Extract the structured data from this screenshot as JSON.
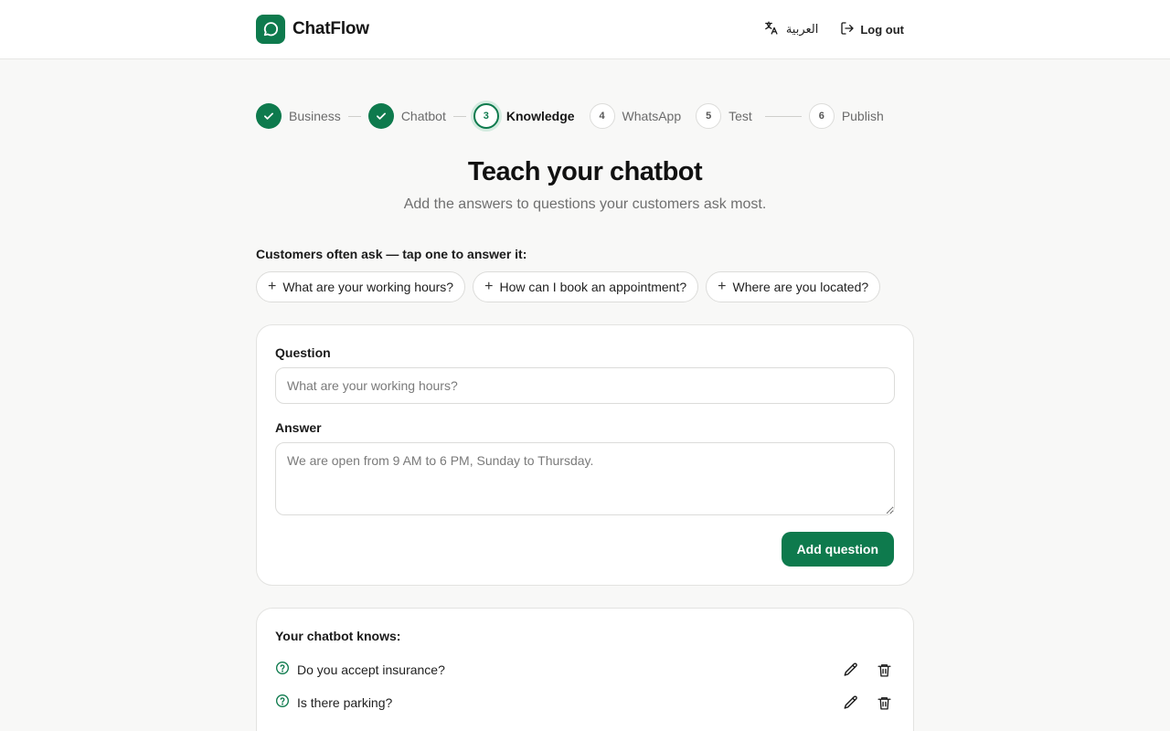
{
  "header": {
    "brand_name": "ChatFlow",
    "language_label": "العربية",
    "logout_label": "Log out"
  },
  "steps": [
    {
      "number": "1",
      "label": "Business",
      "state": "done"
    },
    {
      "number": "2",
      "label": "Chatbot",
      "state": "done"
    },
    {
      "number": "3",
      "label": "Knowledge",
      "state": "current"
    },
    {
      "number": "4",
      "label": "WhatsApp",
      "state": "todo"
    },
    {
      "number": "5",
      "label": "Test",
      "state": "todo"
    },
    {
      "number": "6",
      "label": "Publish",
      "state": "todo"
    }
  ],
  "page": {
    "title": "Teach your chatbot",
    "subtitle": "Add the answers to questions your customers ask most."
  },
  "suggestions": {
    "label": "Customers often ask — tap one to answer it:",
    "chips": [
      "What are your working hours?",
      "How can I book an appointment?",
      "Where are you located?"
    ]
  },
  "form": {
    "question_label": "Question",
    "question_placeholder": "What are your working hours?",
    "question_value": "",
    "answer_label": "Answer",
    "answer_placeholder": "We are open from 9 AM to 6 PM, Sunday to Thursday.",
    "answer_value": "",
    "add_button_label": "Add question"
  },
  "knowledge": {
    "title": "Your chatbot knows:",
    "items": [
      {
        "question": "Do you accept insurance?"
      },
      {
        "question": "Is there parking?"
      }
    ]
  },
  "colors": {
    "accent": "#0e7a4d",
    "accent_ring": "#d4ebe0",
    "background": "#f8f8f7",
    "border": "#dcdcda"
  },
  "icons": {
    "brand": "chat-bubble-icon",
    "language": "translate-icon",
    "logout": "logout-icon",
    "step_done": "check-icon",
    "chip": "plus-icon",
    "question": "help-circle-icon",
    "edit": "pencil-icon",
    "delete": "trash-icon"
  }
}
